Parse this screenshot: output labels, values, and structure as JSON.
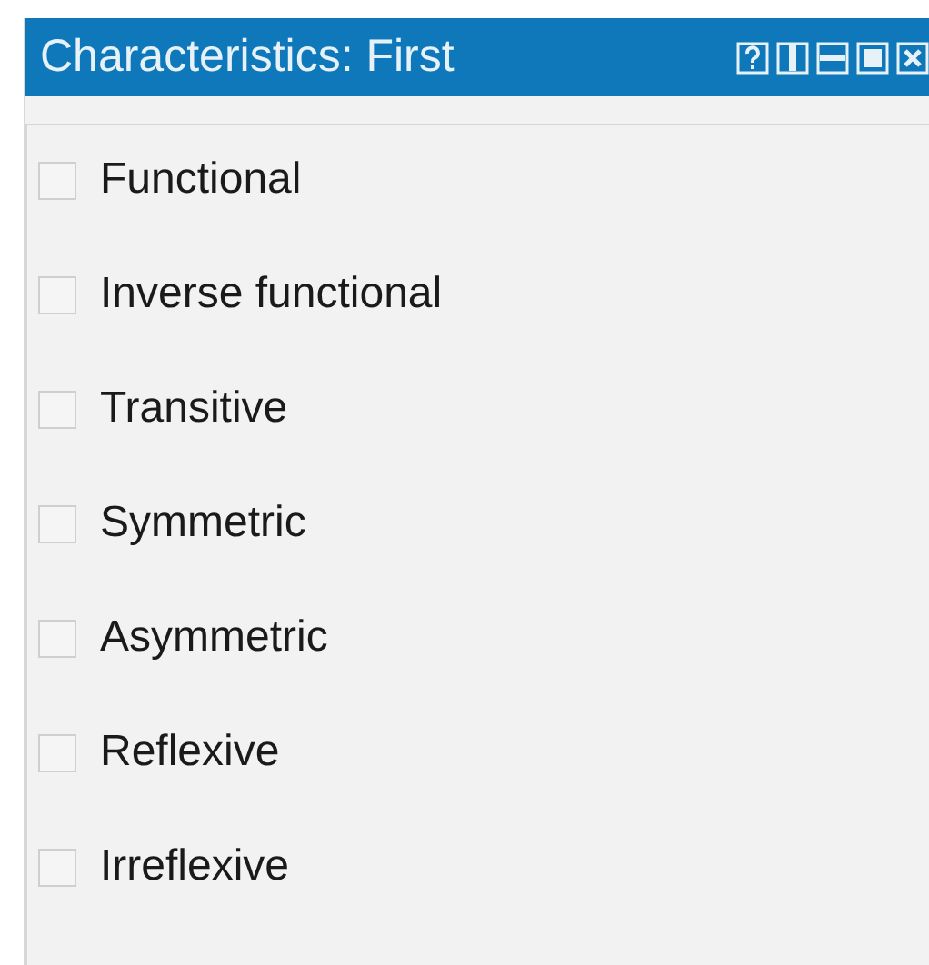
{
  "window": {
    "title": "Characteristics: First"
  },
  "characteristics": [
    {
      "label": "Functional",
      "checked": false
    },
    {
      "label": "Inverse functional",
      "checked": false
    },
    {
      "label": "Transitive",
      "checked": false
    },
    {
      "label": "Symmetric",
      "checked": false
    },
    {
      "label": "Asymmetric",
      "checked": false
    },
    {
      "label": "Reflexive",
      "checked": false
    },
    {
      "label": "Irreflexive",
      "checked": false
    }
  ]
}
